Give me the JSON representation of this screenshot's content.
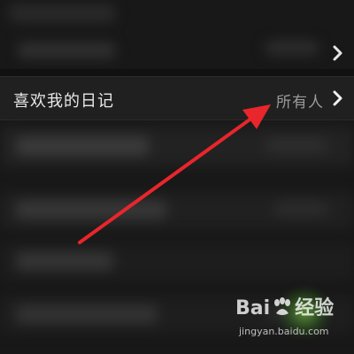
{
  "settings": {
    "row_label": "喜欢我的日记",
    "row_value": "所有人"
  },
  "watermark": {
    "logo_left": "Bai",
    "logo_right": "经验",
    "url": "jingyan.baidu.com"
  },
  "icons": {
    "chevron": "chevron-right-icon",
    "arrow": "red-arrow-annotation",
    "paw": "baidu-paw-icon"
  },
  "colors": {
    "background": "#151515",
    "row_background": "#202020",
    "label": "#e8e8e8",
    "value": "#9a9a9a",
    "arrow": "#e8262b"
  }
}
